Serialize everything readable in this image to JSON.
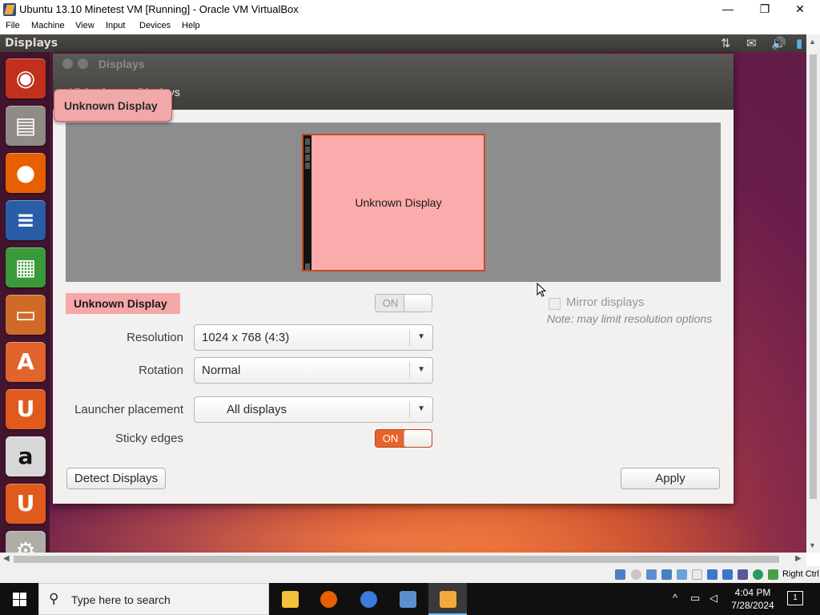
{
  "host_window": {
    "title": "Ubuntu 13.10 Minetest VM [Running] - Oracle VM VirtualBox",
    "controls": {
      "minimize": "—",
      "maximize": "❐",
      "close": "✕"
    },
    "menu": [
      "File",
      "Machine",
      "View",
      "Input",
      "Devices",
      "Help"
    ]
  },
  "guest": {
    "top_panel_title": "Displays",
    "tray_icons": [
      "network-icon",
      "mail-icon",
      "volume-icon",
      "user-icon"
    ],
    "launcher": [
      {
        "name": "dash-home-icon",
        "glyph": "◉",
        "bg": "#c1301d"
      },
      {
        "name": "files-icon",
        "glyph": "▤",
        "bg": "#8f8b85"
      },
      {
        "name": "firefox-icon",
        "glyph": "●",
        "bg": "#e66000"
      },
      {
        "name": "writer-icon",
        "glyph": "≡",
        "bg": "#2a5da8"
      },
      {
        "name": "calc-icon",
        "glyph": "▦",
        "bg": "#3a9a3a"
      },
      {
        "name": "impress-icon",
        "glyph": "▭",
        "bg": "#d06a28"
      },
      {
        "name": "software-center-icon",
        "glyph": "A",
        "bg": "#e0642c"
      },
      {
        "name": "ubuntu-one-icon",
        "glyph": "U",
        "bg": "#e05a1c"
      },
      {
        "name": "amazon-icon",
        "glyph": "a",
        "bg": "#d8d8d8"
      },
      {
        "name": "ubuntu-one-music-icon",
        "glyph": "U",
        "bg": "#e05a1c"
      },
      {
        "name": "system-settings-icon",
        "glyph": "⚙",
        "bg": "#b0aca6"
      }
    ]
  },
  "displays_window": {
    "title": "Displays",
    "breadcrumb": [
      "All Settings",
      "Displays"
    ],
    "tooltip": "Unknown Display",
    "monitor_label": "Unknown Display",
    "display_name": "Unknown Display",
    "power_switch": "ON",
    "resolution": {
      "label": "Resolution",
      "value": "1024 x 768 (4:3)"
    },
    "rotation": {
      "label": "Rotation",
      "value": "Normal"
    },
    "launcher_placement": {
      "label": "Launcher placement",
      "value": "All displays"
    },
    "sticky_edges": {
      "label": "Sticky edges",
      "value": "ON"
    },
    "mirror": {
      "label": "Mirror displays",
      "note": "Note: may limit resolution options"
    },
    "detect_button": "Detect Displays",
    "apply_button": "Apply",
    "accent_color": "#e9622c",
    "badge_color": "#f6a7a7"
  },
  "statusbar": {
    "host_key": "Right Ctrl"
  },
  "taskbar": {
    "search_placeholder": "Type here to search",
    "time": "4:04 PM",
    "date": "7/28/2024",
    "notifications": "1",
    "apps": [
      {
        "name": "file-explorer-taskbar-icon",
        "color": "#f3c23c"
      },
      {
        "name": "firefox-taskbar-icon",
        "color": "#e66000"
      },
      {
        "name": "chrome-taskbar-icon",
        "color": "#3b7bdc"
      },
      {
        "name": "virtualbox-taskbar-icon",
        "color": "#5b8fd0"
      },
      {
        "name": "virtualbox-vm-taskbar-icon",
        "color": "#f2a93b"
      }
    ]
  }
}
